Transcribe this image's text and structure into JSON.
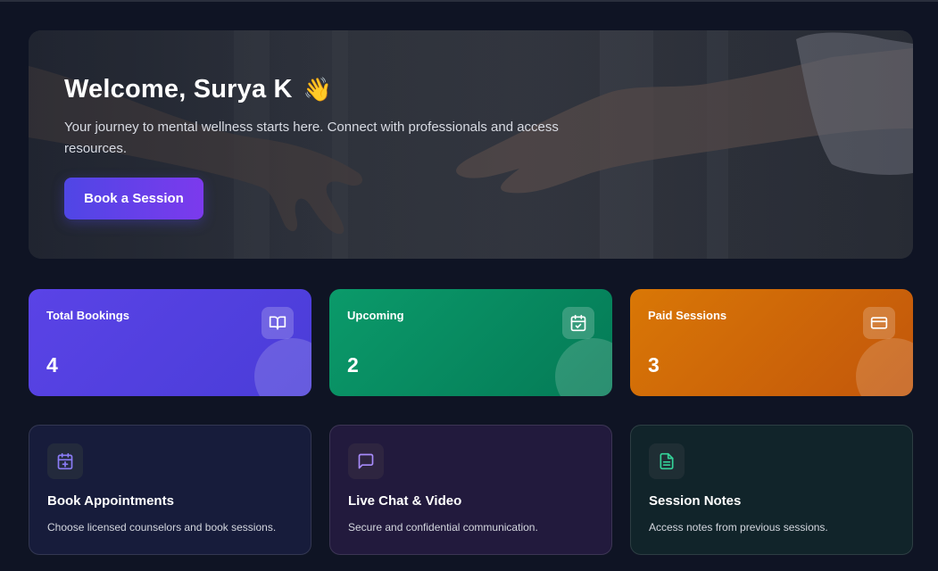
{
  "hero": {
    "title": "Welcome, Surya K",
    "wave_emoji": "👋",
    "subtitle": "Your journey to mental wellness starts here. Connect with professionals and access resources.",
    "cta_label": "Book a Session"
  },
  "stats": [
    {
      "label": "Total Bookings",
      "value": "4",
      "icon": "book-open-icon",
      "color": "#5a43e6"
    },
    {
      "label": "Upcoming",
      "value": "2",
      "icon": "calendar-check-icon",
      "color": "#0b9a6a"
    },
    {
      "label": "Paid Sessions",
      "value": "3",
      "icon": "credit-card-icon",
      "color": "#d97706"
    }
  ],
  "features": [
    {
      "title": "Book Appointments",
      "description": "Choose licensed counselors and book sessions.",
      "icon": "calendar-plus-icon",
      "icon_color": "#8b7cf6"
    },
    {
      "title": "Live Chat & Video",
      "description": "Secure and confidential communication.",
      "icon": "message-square-icon",
      "icon_color": "#a78bfa"
    },
    {
      "title": "Session Notes",
      "description": "Access notes from previous sessions.",
      "icon": "file-text-icon",
      "icon_color": "#34d399"
    }
  ]
}
